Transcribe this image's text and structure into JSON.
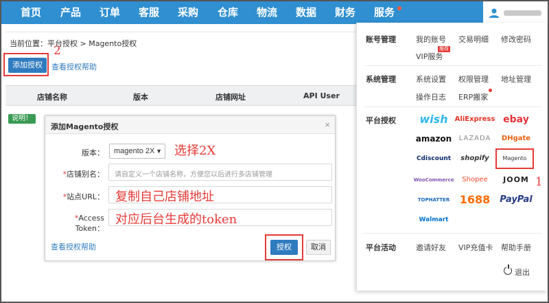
{
  "nav": {
    "items": [
      "首页",
      "产品",
      "订单",
      "客服",
      "采购",
      "仓库",
      "物流",
      "数据",
      "财务",
      "服务"
    ],
    "color": "#2f8fd0"
  },
  "breadcrumb": "当前位置：平台授权 > Magento授权",
  "toolbar": {
    "add_label": "添加授权",
    "help_label": "查看授权帮助"
  },
  "annotations": {
    "num1": "1",
    "num2": "2"
  },
  "table": {
    "headers": [
      "店铺名称",
      "版本",
      "店铺网址",
      "API User"
    ]
  },
  "note_badge": "说明！",
  "modal": {
    "title": "添加Magento授权",
    "version_label": "版本：",
    "version_value": "magento 2X",
    "alias_label": "店铺别名：",
    "alias_placeholder": "请自定义一个店铺名称，方便您以后进行多店铺管理",
    "url_label": "站点URL：",
    "token_label": "Access Token：",
    "hint_version": "选择2X",
    "hint_url": "复制自己店铺地址",
    "hint_token": "对应后台生成的token",
    "help_label": "查看授权帮助",
    "ok_label": "授权",
    "cancel_label": "取消"
  },
  "panel": {
    "account": {
      "title": "账号管理",
      "links": [
        "我的账号",
        "交易明细",
        "修改密码",
        "VIP服务"
      ],
      "hot": "推荐"
    },
    "system": {
      "title": "系统管理",
      "links": [
        "系统设置",
        "权限管理",
        "地址管理",
        "操作日志",
        "ERP搬家"
      ]
    },
    "platform": {
      "title": "平台授权",
      "logos": [
        "wish",
        "AliExpress",
        "ebay",
        "amazon",
        "LAZADA",
        "DHgate",
        "Cdiscount",
        "shopify",
        "Magento",
        "WooCommerce",
        "Shopee",
        "JOOM",
        "TOPHATTER",
        "1688",
        "PayPal",
        "Walmart"
      ]
    },
    "activity": {
      "title": "平台活动",
      "links": [
        "邀请好友",
        "VIP充值卡",
        "帮助手册"
      ]
    },
    "logout": "退出"
  }
}
